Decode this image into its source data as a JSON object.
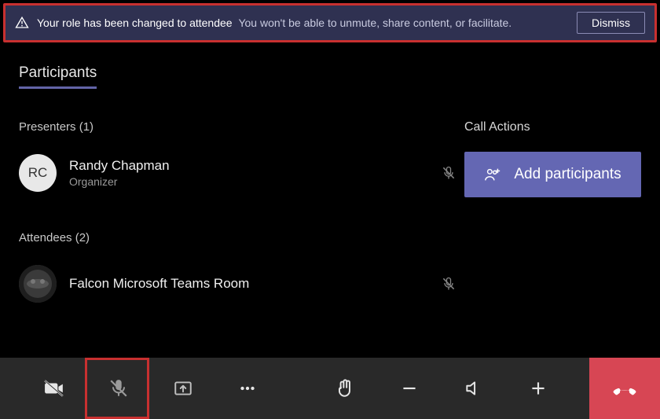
{
  "banner": {
    "primary": "Your role has been changed to attendee",
    "secondary": "You won't be able to unmute, share content, or facilitate.",
    "dismiss": "Dismiss"
  },
  "tab_title": "Participants",
  "presenters": {
    "label": "Presenters (1)",
    "items": [
      {
        "initials": "RC",
        "name": "Randy Chapman",
        "role": "Organizer"
      }
    ]
  },
  "attendees": {
    "label": "Attendees (2)",
    "items": [
      {
        "name": "Falcon Microsoft Teams Room"
      }
    ]
  },
  "call_actions": {
    "label": "Call Actions",
    "add_participants": "Add participants"
  },
  "colors": {
    "accent": "#6264a7",
    "danger": "#d74654",
    "highlight": "#c83030",
    "banner_bg": "#2f3151"
  }
}
